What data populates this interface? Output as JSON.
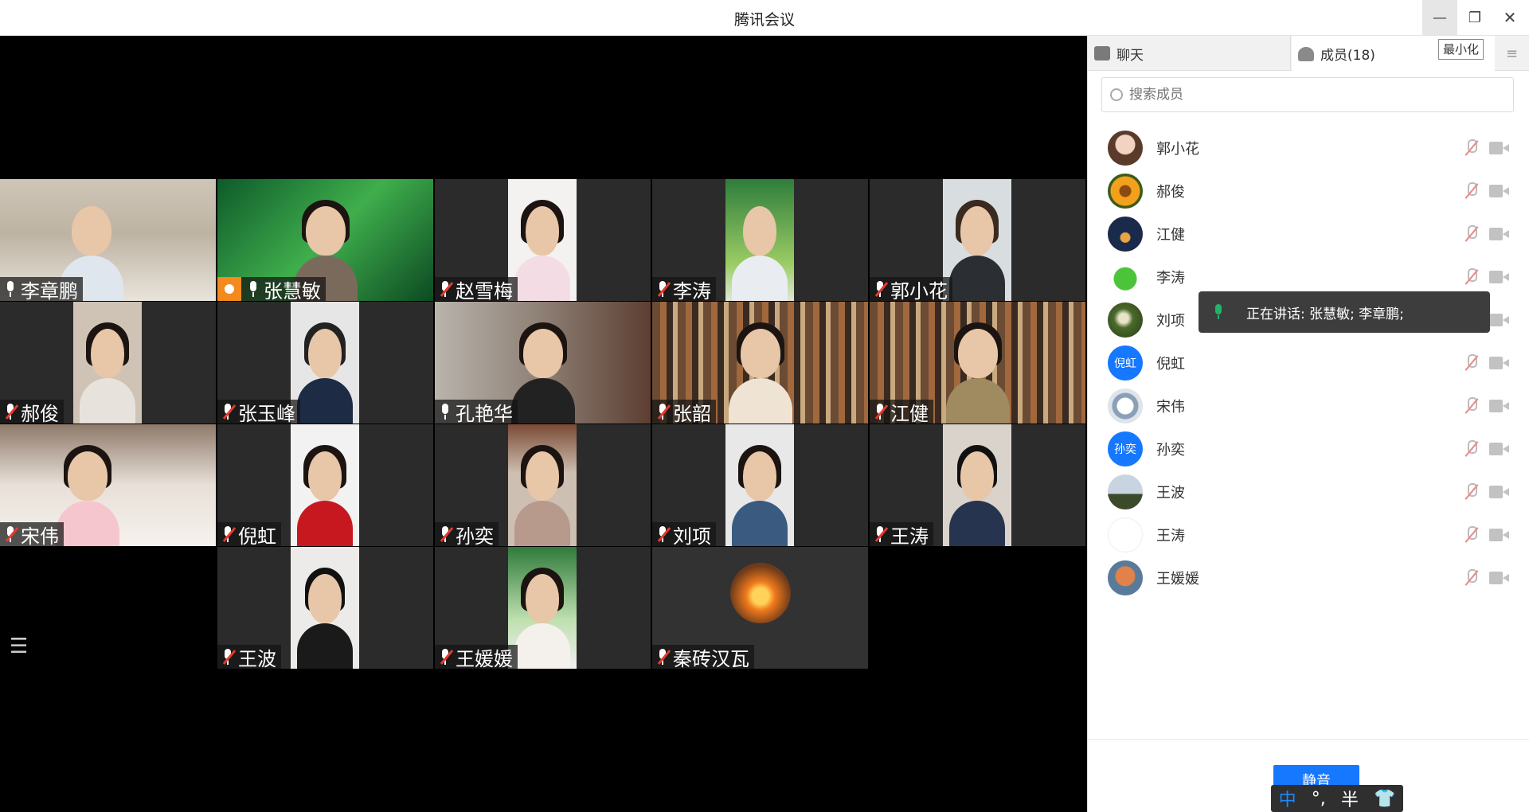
{
  "window": {
    "title": "腾讯会议",
    "minimize_tooltip": "最小化"
  },
  "speaking": {
    "text": "正在讲话: 张慧敏; 李章鹏;"
  },
  "tiles": [
    {
      "name": "李章鹏",
      "mic": "on"
    },
    {
      "name": "张慧敏",
      "mic": "on",
      "host": true,
      "active": true
    },
    {
      "name": "赵雪梅",
      "mic": "off"
    },
    {
      "name": "李涛",
      "mic": "off"
    },
    {
      "name": "郭小花",
      "mic": "off"
    },
    {
      "name": "郝俊",
      "mic": "off"
    },
    {
      "name": "张玉峰",
      "mic": "off"
    },
    {
      "name": "孔艳华",
      "mic": "on"
    },
    {
      "name": "张韶",
      "mic": "off"
    },
    {
      "name": "江健",
      "mic": "off"
    },
    {
      "name": "宋伟",
      "mic": "off"
    },
    {
      "name": "倪虹",
      "mic": "off"
    },
    {
      "name": "孙奕",
      "mic": "off"
    },
    {
      "name": "刘项",
      "mic": "off"
    },
    {
      "name": "王涛",
      "mic": "off"
    },
    {
      "name": "王波",
      "mic": "off"
    },
    {
      "name": "王媛媛",
      "mic": "off"
    },
    {
      "name": "秦砖汉瓦",
      "mic": "off"
    }
  ],
  "panel": {
    "tab_chat": "聊天",
    "tab_members": "成员(18)",
    "search_placeholder": "搜索成员",
    "mute_all": "静音",
    "members": [
      {
        "name": "郭小花",
        "avatar": "photo"
      },
      {
        "name": "郝俊",
        "avatar": "photo"
      },
      {
        "name": "江健",
        "avatar": "photo"
      },
      {
        "name": "李涛",
        "avatar": "photo"
      },
      {
        "name": "刘项",
        "avatar": "photo"
      },
      {
        "name": "倪虹",
        "avatar": "text",
        "avatar_text": "倪虹"
      },
      {
        "name": "宋伟",
        "avatar": "photo"
      },
      {
        "name": "孙奕",
        "avatar": "text",
        "avatar_text": "孙奕"
      },
      {
        "name": "王波",
        "avatar": "photo"
      },
      {
        "name": "王涛",
        "avatar": "photo"
      },
      {
        "name": "王媛媛",
        "avatar": "photo"
      }
    ]
  },
  "ime": {
    "mode": "中",
    "punct": "°,",
    "width": "半"
  },
  "colors": {
    "accent": "#1677ff",
    "speaking_green": "#20b36b",
    "host_orange": "#f48a1d",
    "muted_red": "#e63a2e"
  }
}
